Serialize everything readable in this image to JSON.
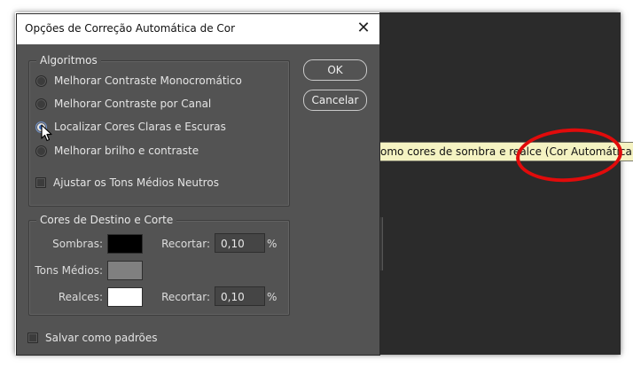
{
  "dialog": {
    "title": "Opções de Correção Automática de Cor",
    "close_glyph": "✕"
  },
  "algorithms": {
    "legend": "Algoritmos",
    "options": [
      {
        "label": "Melhorar Contraste Monocromático",
        "selected": false
      },
      {
        "label": "Melhorar Contraste por Canal",
        "selected": false
      },
      {
        "label": "Localizar Cores Claras e Escuras",
        "selected": true
      },
      {
        "label": "Melhorar brilho e contraste",
        "selected": false
      }
    ],
    "neutral_midtones": {
      "label": "Ajustar os Tons Médios Neutros",
      "checked": false
    }
  },
  "buttons": {
    "ok": "OK",
    "cancel": "Cancelar"
  },
  "targets": {
    "legend": "Cores de Destino e Corte",
    "shadows": {
      "label": "Sombras:",
      "color": "#000000",
      "clip_label": "Recortar:",
      "clip_value": "0,10",
      "unit": "%"
    },
    "midtones": {
      "label": "Tons Médios:",
      "color": "#808080"
    },
    "highlights": {
      "label": "Realces:",
      "color": "#ffffff",
      "clip_label": "Recortar:",
      "clip_value": "0,10",
      "unit": "%"
    }
  },
  "save_defaults": {
    "label": "Salvar como padrões",
    "checked": false
  },
  "tooltip": {
    "text": "omo cores de sombra e realce (Cor Automáticar)"
  },
  "colors": {
    "annotation": "#e10b0b",
    "dialog_bg": "#535353",
    "app_bg": "#2b2b2b"
  }
}
